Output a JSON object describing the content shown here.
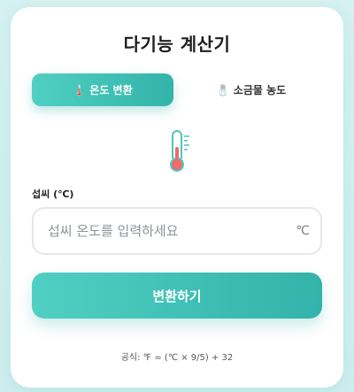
{
  "app": {
    "title": "다기능 계산기"
  },
  "tabs": [
    {
      "label": "온도 변환",
      "icon": "🌡️",
      "icon_name": "thermometer-icon",
      "active": true
    },
    {
      "label": "소금물 농도",
      "icon": "🧂",
      "icon_name": "salt-shaker-icon",
      "active": false
    }
  ],
  "temperature": {
    "icon_name": "thermometer-icon",
    "field_label": "섭씨 (℃)",
    "input_value": "",
    "input_placeholder": "섭씨 온도를 입력하세요",
    "unit": "℃",
    "convert_label": "변환하기",
    "formula": "공식: ℉ = (℃ × 9/5) + 32"
  },
  "colors": {
    "accent_start": "#4fd0c2",
    "accent_end": "#33b3a9",
    "thermometer_fill": "#f06b6b",
    "thermometer_outline": "#4fc6bb",
    "background": "#d6f1f1"
  }
}
